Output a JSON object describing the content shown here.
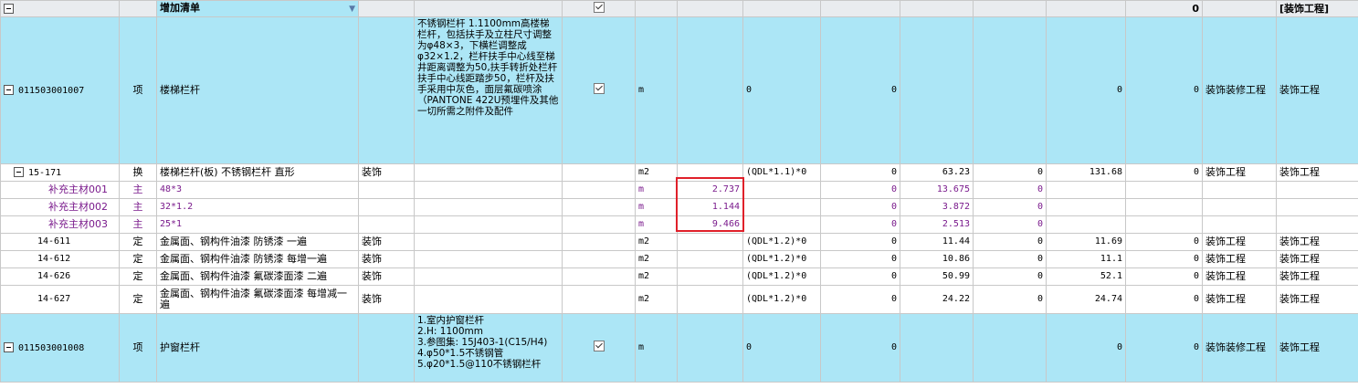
{
  "header": {
    "group_name": "增加清单",
    "total": "0",
    "category": "[装饰工程]"
  },
  "rows": [
    {
      "code": "011503001007",
      "type": "项",
      "name": "楼梯栏杆",
      "spec": "",
      "desc": "不锈钢栏杆\n1.1100mm高楼梯栏杆，包括扶手及立柱尺寸调整为φ48×3，下横栏调整成φ32×1.2，栏杆扶手中心线至梯井距离调整为50,扶手转折处栏杆扶手中心线距踏步50，栏杆及扶手采用中灰色，面层氟碳喷涂（PANTONE 422U预埋件及其他一切所需之附件及配件",
      "unit": "m",
      "qty": "",
      "formula": "0",
      "c1": "0",
      "c2": "",
      "c3": "",
      "c4": "0",
      "c5": "0",
      "major": "装饰装修工程",
      "prof": "装饰工程"
    }
  ],
  "sub_rows": [
    {
      "code": "15-171",
      "type": "换",
      "name": "楼梯栏杆(板) 不锈钢栏杆 直形",
      "spec": "装饰",
      "unit": "m2",
      "qty": "",
      "formula": "(QDL*1.1)*0",
      "c1": "0",
      "c2": "63.23",
      "c3": "0",
      "c4": "131.68",
      "c5": "0",
      "major": "装饰工程",
      "prof": "装饰工程"
    },
    {
      "code": "补充主材001",
      "type": "主",
      "name": "48*3",
      "spec": "",
      "unit": "m",
      "qty": "2.737",
      "formula": "",
      "c1": "0",
      "c2": "13.675",
      "c3": "0",
      "c4": "",
      "c5": "",
      "major": "",
      "prof": ""
    },
    {
      "code": "补充主材002",
      "type": "主",
      "name": "32*1.2",
      "spec": "",
      "unit": "m",
      "qty": "1.144",
      "formula": "",
      "c1": "0",
      "c2": "3.872",
      "c3": "0",
      "c4": "",
      "c5": "",
      "major": "",
      "prof": ""
    },
    {
      "code": "补充主材003",
      "type": "主",
      "name": "25*1",
      "spec": "",
      "unit": "m",
      "qty": "9.466",
      "formula": "",
      "c1": "0",
      "c2": "2.513",
      "c3": "0",
      "c4": "",
      "c5": "",
      "major": "",
      "prof": ""
    },
    {
      "code": "14-611",
      "type": "定",
      "name": "金属面、钢构件油漆 防锈漆 一遍",
      "spec": "装饰",
      "unit": "m2",
      "qty": "",
      "formula": "(QDL*1.2)*0",
      "c1": "0",
      "c2": "11.44",
      "c3": "0",
      "c4": "11.69",
      "c5": "0",
      "major": "装饰工程",
      "prof": "装饰工程"
    },
    {
      "code": "14-612",
      "type": "定",
      "name": "金属面、钢构件油漆 防锈漆 每增一遍",
      "spec": "装饰",
      "unit": "m2",
      "qty": "",
      "formula": "(QDL*1.2)*0",
      "c1": "0",
      "c2": "10.86",
      "c3": "0",
      "c4": "11.1",
      "c5": "0",
      "major": "装饰工程",
      "prof": "装饰工程"
    },
    {
      "code": "14-626",
      "type": "定",
      "name": "金属面、钢构件油漆 氟碳漆面漆 二遍",
      "spec": "装饰",
      "unit": "m2",
      "qty": "",
      "formula": "(QDL*1.2)*0",
      "c1": "0",
      "c2": "50.99",
      "c3": "0",
      "c4": "52.1",
      "c5": "0",
      "major": "装饰工程",
      "prof": "装饰工程"
    },
    {
      "code": "14-627",
      "type": "定",
      "name": "金属面、钢构件油漆 氟碳漆面漆 每增减一遍",
      "spec": "装饰",
      "unit": "m2",
      "qty": "",
      "formula": "(QDL*1.2)*0",
      "c1": "0",
      "c2": "24.22",
      "c3": "0",
      "c4": "24.74",
      "c5": "0",
      "major": "装饰工程",
      "prof": "装饰工程"
    }
  ],
  "row2": {
    "code": "011503001008",
    "type": "项",
    "name": "护窗栏杆",
    "desc": "1.室内护窗栏杆\n2.H: 1100mm\n3.参图集: 15J403-1(C15/H4)\n4.φ50*1.5不锈钢管\n5.φ20*1.5@110不锈钢栏杆",
    "unit": "m",
    "formula": "0",
    "c1": "0",
    "c4": "0",
    "c5": "0",
    "major": "装饰装修工程",
    "prof": "装饰工程"
  },
  "colors": {
    "row_blue": "#ace6f6",
    "material_text": "#7a1a8c",
    "highlight_box": "#e0202a"
  }
}
